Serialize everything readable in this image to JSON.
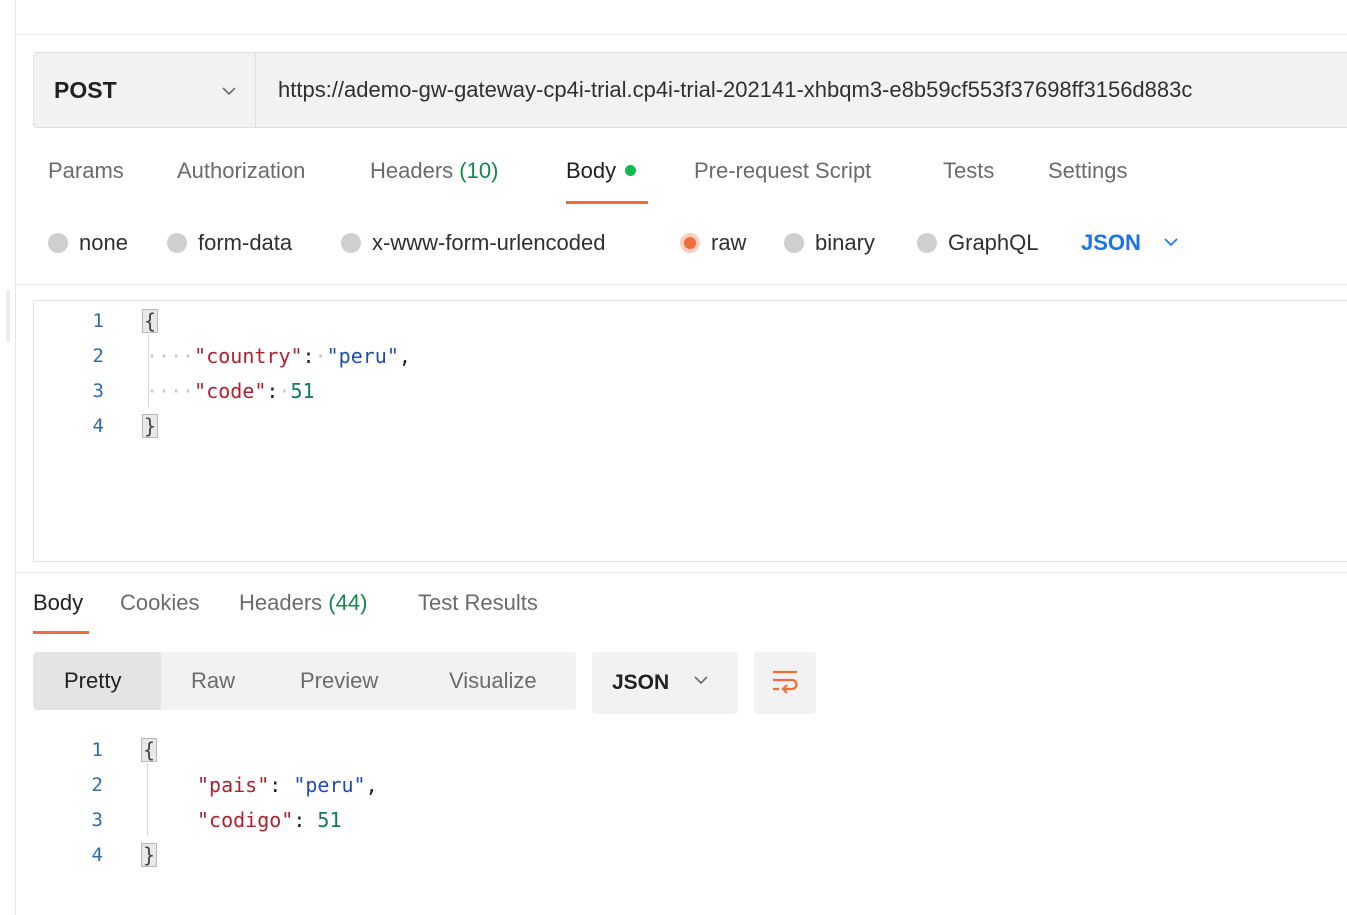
{
  "request": {
    "method": "POST",
    "url": "https://ademo-gw-gateway-cp4i-trial.cp4i-trial-202141-xhbqm3-e8b59cf553f37698ff3156d883c"
  },
  "request_tabs": [
    {
      "label": "Params"
    },
    {
      "label": "Authorization"
    },
    {
      "label": "Headers",
      "count": "(10)"
    },
    {
      "label": "Body",
      "active": true
    },
    {
      "label": "Pre-request Script"
    },
    {
      "label": "Tests"
    },
    {
      "label": "Settings"
    }
  ],
  "body_types": [
    "none",
    "form-data",
    "x-www-form-urlencoded",
    "raw",
    "binary",
    "GraphQL"
  ],
  "body_type_selected": "raw",
  "body_language": "JSON",
  "request_body": {
    "line_numbers": [
      "1",
      "2",
      "3",
      "4"
    ],
    "open_brace": "{",
    "close_brace": "}",
    "key1": "\"country\"",
    "val1": "\"peru\"",
    "key2": "\"code\"",
    "val2": "51",
    "whitespace_dots": "····"
  },
  "response_tabs": [
    {
      "label": "Body",
      "active": true
    },
    {
      "label": "Cookies"
    },
    {
      "label": "Headers",
      "count": "(44)"
    },
    {
      "label": "Test Results"
    }
  ],
  "response_views": [
    "Pretty",
    "Raw",
    "Preview",
    "Visualize"
  ],
  "response_view_selected": "Pretty",
  "response_language": "JSON",
  "response_body": {
    "line_numbers": [
      "1",
      "2",
      "3",
      "4"
    ],
    "open_brace": "{",
    "close_brace": "}",
    "key1": "\"pais\"",
    "val1": "\"peru\"",
    "key2": "\"codigo\"",
    "val2": "51"
  },
  "colors": {
    "accent": "#f26b3a",
    "link_blue": "#1a73e8",
    "count_green": "#0f8a4a",
    "status_dot": "#0cbb52"
  },
  "icons": [
    "chevron-down-icon",
    "word-wrap-icon"
  ]
}
